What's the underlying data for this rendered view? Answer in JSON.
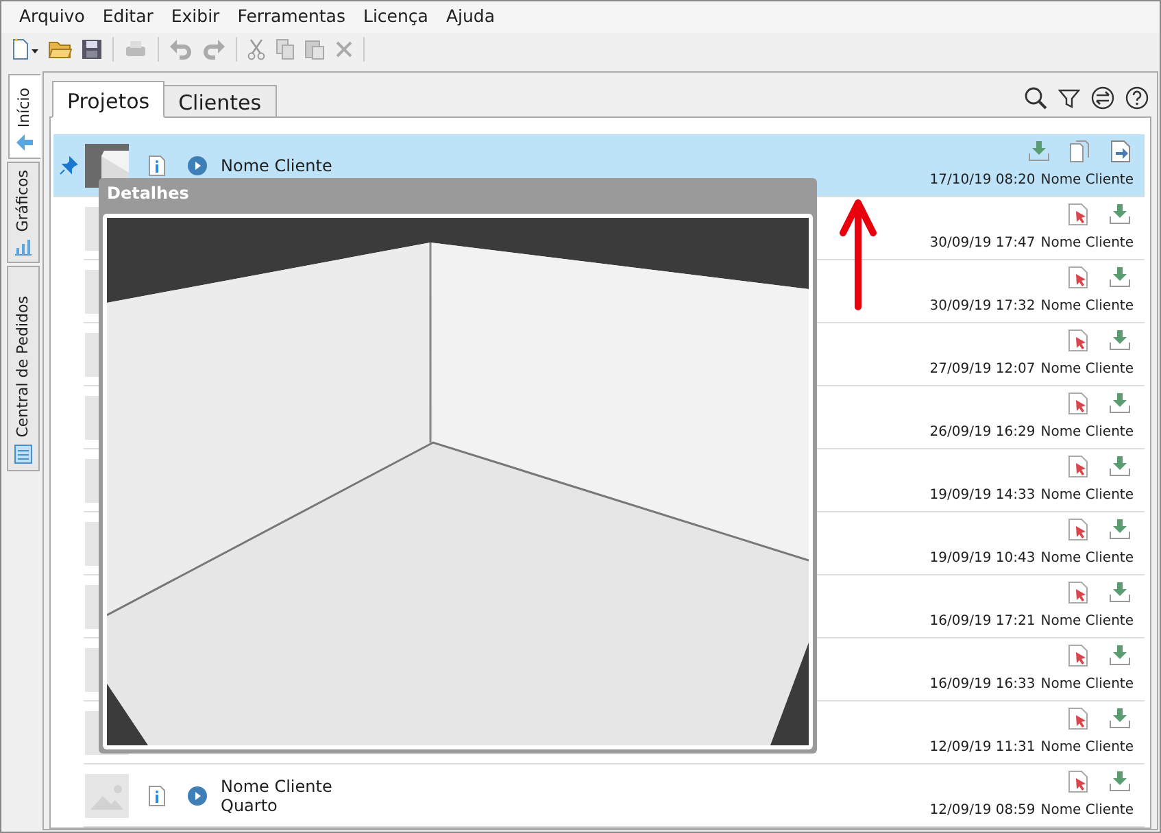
{
  "menu": [
    "Arquivo",
    "Editar",
    "Exibir",
    "Ferramentas",
    "Licença",
    "Ajuda"
  ],
  "side_tabs": [
    {
      "label": "Início",
      "selected": true
    },
    {
      "label": "Gráficos",
      "selected": false
    },
    {
      "label": "Central de Pedidos",
      "selected": false
    }
  ],
  "tabs": [
    {
      "label": "Projetos",
      "selected": true
    },
    {
      "label": "Clientes",
      "selected": false
    }
  ],
  "rows": [
    {
      "kind": "picture",
      "selected": true,
      "pinned": true,
      "client": "Nome Cliente",
      "date": "17/10/19 08:20",
      "owner": "Nome Cliente"
    },
    {
      "kind": "covered",
      "selected": false,
      "date": "30/09/19 17:47",
      "owner": "Nome Cliente"
    },
    {
      "kind": "covered",
      "selected": false,
      "date": "30/09/19 17:32",
      "owner": "Nome Cliente"
    },
    {
      "kind": "covered",
      "selected": false,
      "date": "27/09/19 12:07",
      "owner": "Nome Cliente"
    },
    {
      "kind": "covered",
      "selected": false,
      "date": "26/09/19 16:29",
      "owner": "Nome Cliente"
    },
    {
      "kind": "covered",
      "selected": false,
      "date": "19/09/19 14:33",
      "owner": "Nome Cliente"
    },
    {
      "kind": "covered",
      "selected": false,
      "date": "19/09/19 10:43",
      "owner": "Nome Cliente"
    },
    {
      "kind": "covered",
      "selected": false,
      "date": "16/09/19 17:21",
      "owner": "Nome Cliente"
    },
    {
      "kind": "covered",
      "selected": false,
      "date": "16/09/19 16:33",
      "owner": "Nome Cliente"
    },
    {
      "kind": "covered",
      "selected": false,
      "date": "12/09/19 11:31",
      "owner": "Nome Cliente"
    },
    {
      "kind": "placeholder",
      "selected": false,
      "client": "Nome Cliente",
      "room": "Quarto",
      "date": "12/09/19 08:59",
      "owner": "Nome Cliente"
    }
  ],
  "details": {
    "title": "Detalhes",
    "kind": "picture"
  }
}
